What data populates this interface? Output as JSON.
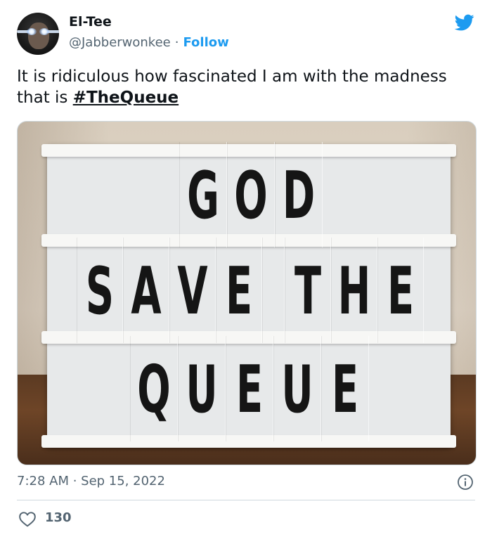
{
  "tweet": {
    "author_name": "El-Tee",
    "author_handle": "@Jabberwonkee",
    "separator": "·",
    "follow_label": "Follow",
    "text_prefix": "It is ridiculous how fascinated I am with the madness that is ",
    "hashtag": "#TheQueue",
    "timestamp": "7:28 AM · Sep 15, 2022",
    "like_count": "130"
  },
  "photo": {
    "sign_lines": [
      [
        "G",
        "O",
        "D"
      ],
      [
        "S",
        "A",
        "V",
        "E",
        "",
        "T",
        "H",
        "E"
      ],
      [
        "Q",
        "U",
        "E",
        "U",
        "E"
      ]
    ]
  },
  "colors": {
    "accent": "#1d9bf0",
    "text": "#0f1419",
    "muted": "#536471",
    "border": "#cfd9de"
  },
  "icons": {
    "brand": "twitter-bird-icon",
    "info": "info-icon",
    "like": "heart-icon"
  }
}
